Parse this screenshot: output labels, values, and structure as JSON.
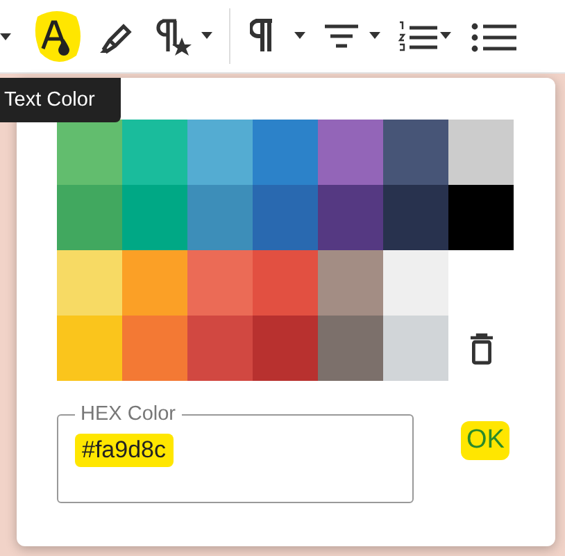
{
  "tooltip": "Text Color",
  "palette": [
    [
      {
        "color": "#62bd6e"
      },
      {
        "color": "#1abc9c"
      },
      {
        "color": "#54acd2"
      },
      {
        "color": "#2c82c9"
      },
      {
        "color": "#9365b8"
      },
      {
        "color": "#475577"
      },
      {
        "color": "#cccccc"
      }
    ],
    [
      {
        "color": "#41a85f"
      },
      {
        "color": "#00a885"
      },
      {
        "color": "#3d8eb9"
      },
      {
        "color": "#2969b0"
      },
      {
        "color": "#553982"
      },
      {
        "color": "#28324e"
      },
      {
        "color": "#000000"
      }
    ],
    [
      {
        "color": "#f7da64"
      },
      {
        "color": "#fba026"
      },
      {
        "color": "#eb6b56"
      },
      {
        "color": "#e25041"
      },
      {
        "color": "#a38d84"
      },
      {
        "color": "#efefef"
      }
    ],
    [
      {
        "color": "#fac51c"
      },
      {
        "color": "#f37934"
      },
      {
        "color": "#d14841"
      },
      {
        "color": "#b8312f"
      },
      {
        "color": "#7c706b"
      },
      {
        "color": "#d1d5d8"
      }
    ]
  ],
  "hex_field": {
    "label": "HEX Color",
    "value": "#fa9d8c"
  },
  "ok_button": "OK"
}
